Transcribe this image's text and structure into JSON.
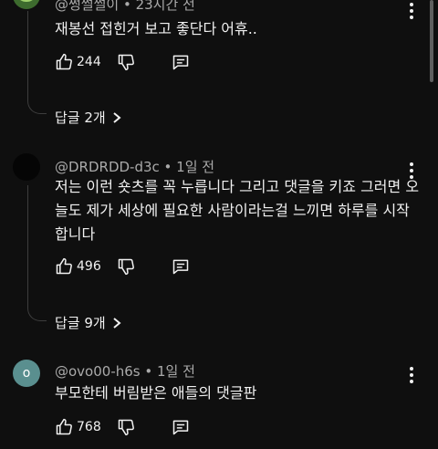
{
  "comments": [
    {
      "handle": "@썽썰썰이 • 23시간 전",
      "text": "재봉선 접힌거 보고 좋단다 어휴..",
      "likes": "244",
      "replies": "답글 2개"
    },
    {
      "handle": "@DRDRDD-d3c • 1일 전",
      "text": "저는 이런 숏츠를 꼭 누릅니다 그리고 댓글을 키죠 그러면 오늘도 제가 세상에 필요한 사람이라는걸 느끼면 하루를 시작합니다",
      "likes": "496",
      "replies": "답글 9개"
    },
    {
      "handle": "@ovo00-h6s • 1일 전",
      "text": "부모한테 버림받은 애들의 댓글판",
      "likes": "768",
      "avatar_letter": "o",
      "avatar_color": "#5a8f8f"
    }
  ]
}
